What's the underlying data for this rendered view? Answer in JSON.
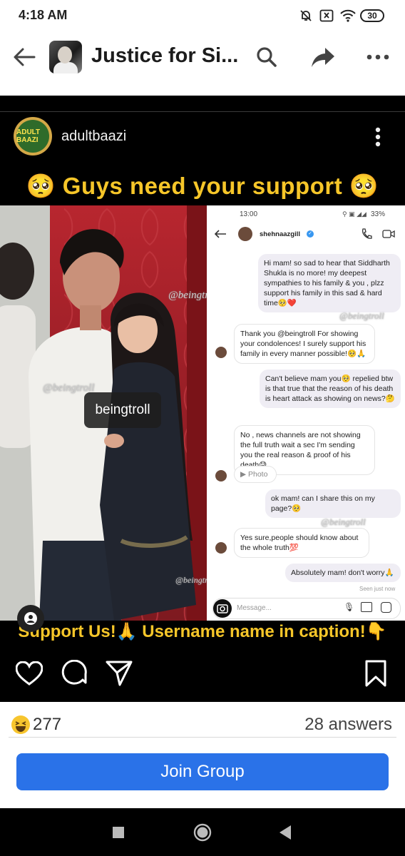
{
  "status_bar": {
    "time": "4:18 AM",
    "battery": "30",
    "icons": [
      "bell-off-icon",
      "box-x-icon",
      "wifi-icon",
      "battery-icon"
    ]
  },
  "header": {
    "title": "Justice for Si...",
    "back_icon": "arrow-left-icon",
    "search_icon": "search-icon",
    "share_icon": "share-arrow-icon",
    "more_icon": "more-horizontal-icon"
  },
  "post": {
    "username": "adultbaazi",
    "avatar_text": "ADULT BAAZI",
    "headline": "🥺 Guys need your support 🥺",
    "image_tag": "beingtroll",
    "watermark": "@beingtroll",
    "banner": "Support Us!🙏 Username name in caption!👇",
    "chat": {
      "time": "13:00",
      "status": "33%",
      "contact": "shehnaazgill",
      "messages": [
        {
          "dir": "out",
          "text": "Hi mam! so sad to hear that Siddharth Shukla is no more! my deepest sympathies to his family & you , plzz support his family in this sad & hard time🥺❤️"
        },
        {
          "dir": "in",
          "text": "Thank you @beingtroll For showing your condolences! I surely support his family in every manner possible!🥺🙏"
        },
        {
          "dir": "out",
          "text": "Can't believe mam you🥺 repelied btw is that true that the reason of his death is heart attack as showing on news?🤔"
        },
        {
          "dir": "in",
          "text": "No , news channels are not showing the full truth wait a sec I'm sending you the real reason & proof of his death😓"
        },
        {
          "dir": "in",
          "text": "▶ Photo"
        },
        {
          "dir": "out",
          "text": "ok mam! can I share this on my page?🥺"
        },
        {
          "dir": "in",
          "text": "Yes sure,people should know about the whole truth💯"
        },
        {
          "dir": "out",
          "text": "Absolutely mam! don't worry🙏"
        }
      ],
      "seen": "Seen just now",
      "placeholder": "Message..."
    }
  },
  "footer": {
    "reaction_count": "277",
    "answers": "28 answers",
    "join_label": "Join Group"
  },
  "colors": {
    "accent": "#2a72e8",
    "banner_text": "#f6c629",
    "post_bg": "#000000"
  }
}
